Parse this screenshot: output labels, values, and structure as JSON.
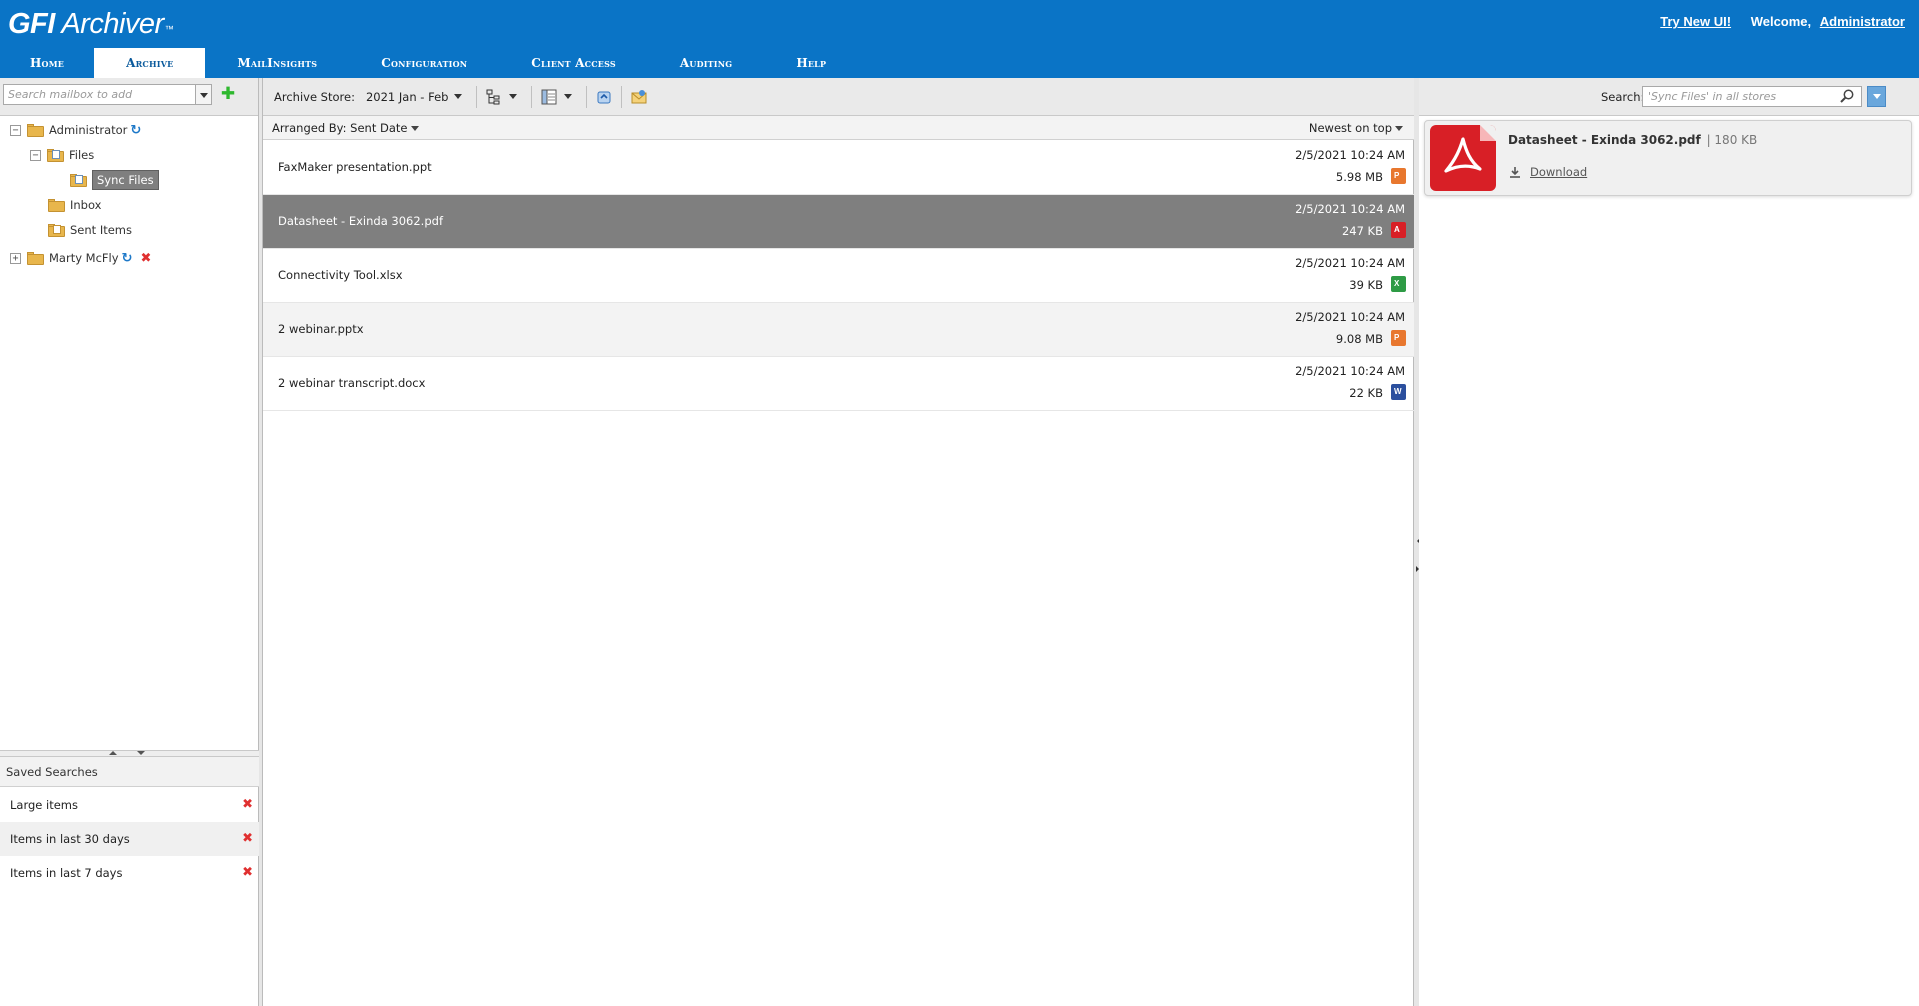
{
  "app": {
    "logo_bold": "GFI",
    "logo_rest": " Archiver",
    "logo_tm": "™",
    "try_new_ui": "Try New UI!",
    "welcome": "Welcome,",
    "user": "Administrator"
  },
  "nav": {
    "tabs": [
      "Home",
      "Archive",
      "MailInsights",
      "Configuration",
      "Client Access",
      "Auditing",
      "Help"
    ],
    "active": "Archive"
  },
  "sidebar": {
    "mailbox_search_placeholder": "Search mailbox to add",
    "tree": {
      "administrator": "Administrator",
      "files": "Files",
      "sync_files": "Sync Files",
      "inbox": "Inbox",
      "sent_items": "Sent Items",
      "marty": "Marty McFly"
    },
    "saved_searches_title": "Saved Searches",
    "saved_searches": [
      "Large items",
      "Items in last 30 days",
      "Items in last 7 days"
    ]
  },
  "toolbar": {
    "archive_store_label": "Archive Store:",
    "archive_store_value": "2021 Jan - Feb"
  },
  "list": {
    "arranged_by": "Arranged By: Sent Date",
    "sort_order": "Newest on top",
    "items": [
      {
        "name": "FaxMaker presentation.ppt",
        "date": "2/5/2021 10:24 AM",
        "size": "5.98 MB",
        "icon": "ppt-icon",
        "color": "#e8772e",
        "glyph": "P"
      },
      {
        "name": "Datasheet - Exinda 3062.pdf",
        "date": "2/5/2021 10:24 AM",
        "size": "247 KB",
        "icon": "pdf-icon",
        "color": "#d81f26",
        "glyph": "A"
      },
      {
        "name": "Connectivity Tool.xlsx",
        "date": "2/5/2021 10:24 AM",
        "size": "39 KB",
        "icon": "excel-icon",
        "color": "#2e9b45",
        "glyph": "X"
      },
      {
        "name": "2 webinar.pptx",
        "date": "2/5/2021 10:24 AM",
        "size": "9.08 MB",
        "icon": "ppt-icon",
        "color": "#e8772e",
        "glyph": "P"
      },
      {
        "name": "2 webinar transcript.docx",
        "date": "2/5/2021 10:24 AM",
        "size": "22 KB",
        "icon": "word-icon",
        "color": "#2b4f9e",
        "glyph": "W"
      }
    ]
  },
  "search": {
    "label": "Search:",
    "placeholder": "'Sync Files' in all stores"
  },
  "preview": {
    "title": "Datasheet - Exinda 3062.pdf",
    "size": "180 KB",
    "download": "Download"
  },
  "colors": {
    "header_blue": "#0a74c6",
    "selected_row": "#7f7f7f",
    "delete_red": "#e03030"
  }
}
